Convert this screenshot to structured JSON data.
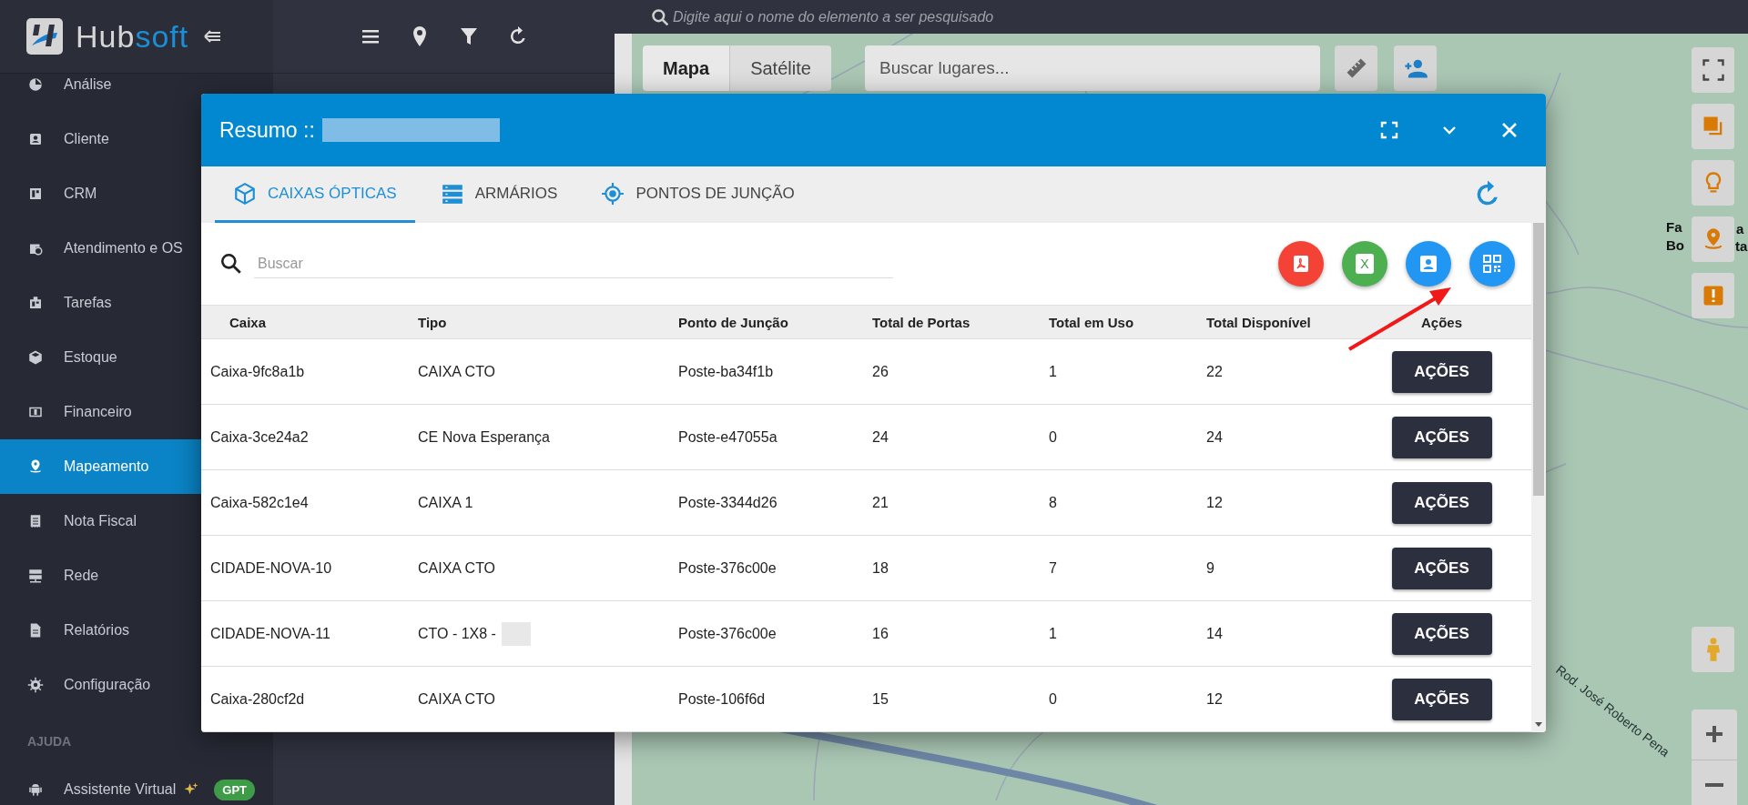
{
  "sidebar": {
    "logo": {
      "text": "Hub",
      "accent": "soft"
    },
    "items": [
      {
        "label": "Análise",
        "selected": false
      },
      {
        "label": "Cliente",
        "selected": false
      },
      {
        "label": "CRM",
        "selected": false
      },
      {
        "label": "Atendimento e OS",
        "selected": false
      },
      {
        "label": "Tarefas",
        "selected": false
      },
      {
        "label": "Estoque",
        "selected": false
      },
      {
        "label": "Financeiro",
        "selected": false
      },
      {
        "label": "Mapeamento",
        "selected": true
      },
      {
        "label": "Nota Fiscal",
        "selected": false
      },
      {
        "label": "Rede",
        "selected": false
      },
      {
        "label": "Relatórios",
        "selected": false
      },
      {
        "label": "Configuração",
        "selected": false
      }
    ],
    "section_label": "AJUDA",
    "help_item": {
      "label": "Assistente Virtual",
      "badge": "GPT"
    }
  },
  "map": {
    "search_placeholder": "Digite aqui o nome do elemento a ser pesquisado",
    "map_types": [
      {
        "label": "Mapa",
        "selected": true
      },
      {
        "label": "Satélite",
        "selected": false
      }
    ],
    "places_placeholder": "Buscar lugares...",
    "place_label": [
      {
        "left": "Fa",
        "right": "a"
      },
      {
        "left": "Bo",
        "right": "ta"
      }
    ],
    "road_label": "Rod. José Roberto Pena"
  },
  "modal": {
    "title": "Resumo ::",
    "tabs": [
      {
        "label": "CAIXAS ÓPTICAS",
        "selected": true
      },
      {
        "label": "ARMÁRIOS",
        "selected": false
      },
      {
        "label": "PONTOS DE JUNÇÃO",
        "selected": false
      }
    ],
    "search_placeholder": "Buscar",
    "export_buttons": [
      {
        "kind": "pdf",
        "color": "#f44336"
      },
      {
        "kind": "excel",
        "color": "#4caf50",
        "label": "X"
      },
      {
        "kind": "contact",
        "color": "#2196f3"
      },
      {
        "kind": "qr",
        "color": "#2196f3"
      }
    ],
    "columns": [
      "Caixa",
      "Tipo",
      "Ponto de Junção",
      "Total de Portas",
      "Total em Uso",
      "Total Disponível",
      "Ações"
    ],
    "rows": [
      {
        "caixa": "Caixa-9fc8a1b",
        "tipo": "CAIXA CTO",
        "redacted": false,
        "ponto": "Poste-ba34f1b",
        "portas": "26",
        "uso": "1",
        "disponivel": "22",
        "action": "AÇÕES"
      },
      {
        "caixa": "Caixa-3ce24a2",
        "tipo": "CE Nova Esperança",
        "redacted": false,
        "ponto": "Poste-e47055a",
        "portas": "24",
        "uso": "0",
        "disponivel": "24",
        "action": "AÇÕES"
      },
      {
        "caixa": "Caixa-582c1e4",
        "tipo": "CAIXA 1",
        "redacted": false,
        "ponto": "Poste-3344d26",
        "portas": "21",
        "uso": "8",
        "disponivel": "12",
        "action": "AÇÕES"
      },
      {
        "caixa": "CIDADE-NOVA-10",
        "tipo": "CAIXA CTO",
        "redacted": false,
        "ponto": "Poste-376c00e",
        "portas": "18",
        "uso": "7",
        "disponivel": "9",
        "action": "AÇÕES"
      },
      {
        "caixa": "CIDADE-NOVA-11",
        "tipo": "CTO - 1X8 -",
        "redacted": true,
        "ponto": "Poste-376c00e",
        "portas": "16",
        "uso": "1",
        "disponivel": "14",
        "action": "AÇÕES"
      },
      {
        "caixa": "Caixa-280cf2d",
        "tipo": "CAIXA CTO",
        "redacted": false,
        "ponto": "Poste-106f6d",
        "portas": "15",
        "uso": "0",
        "disponivel": "12",
        "action": "AÇÕES"
      }
    ]
  }
}
